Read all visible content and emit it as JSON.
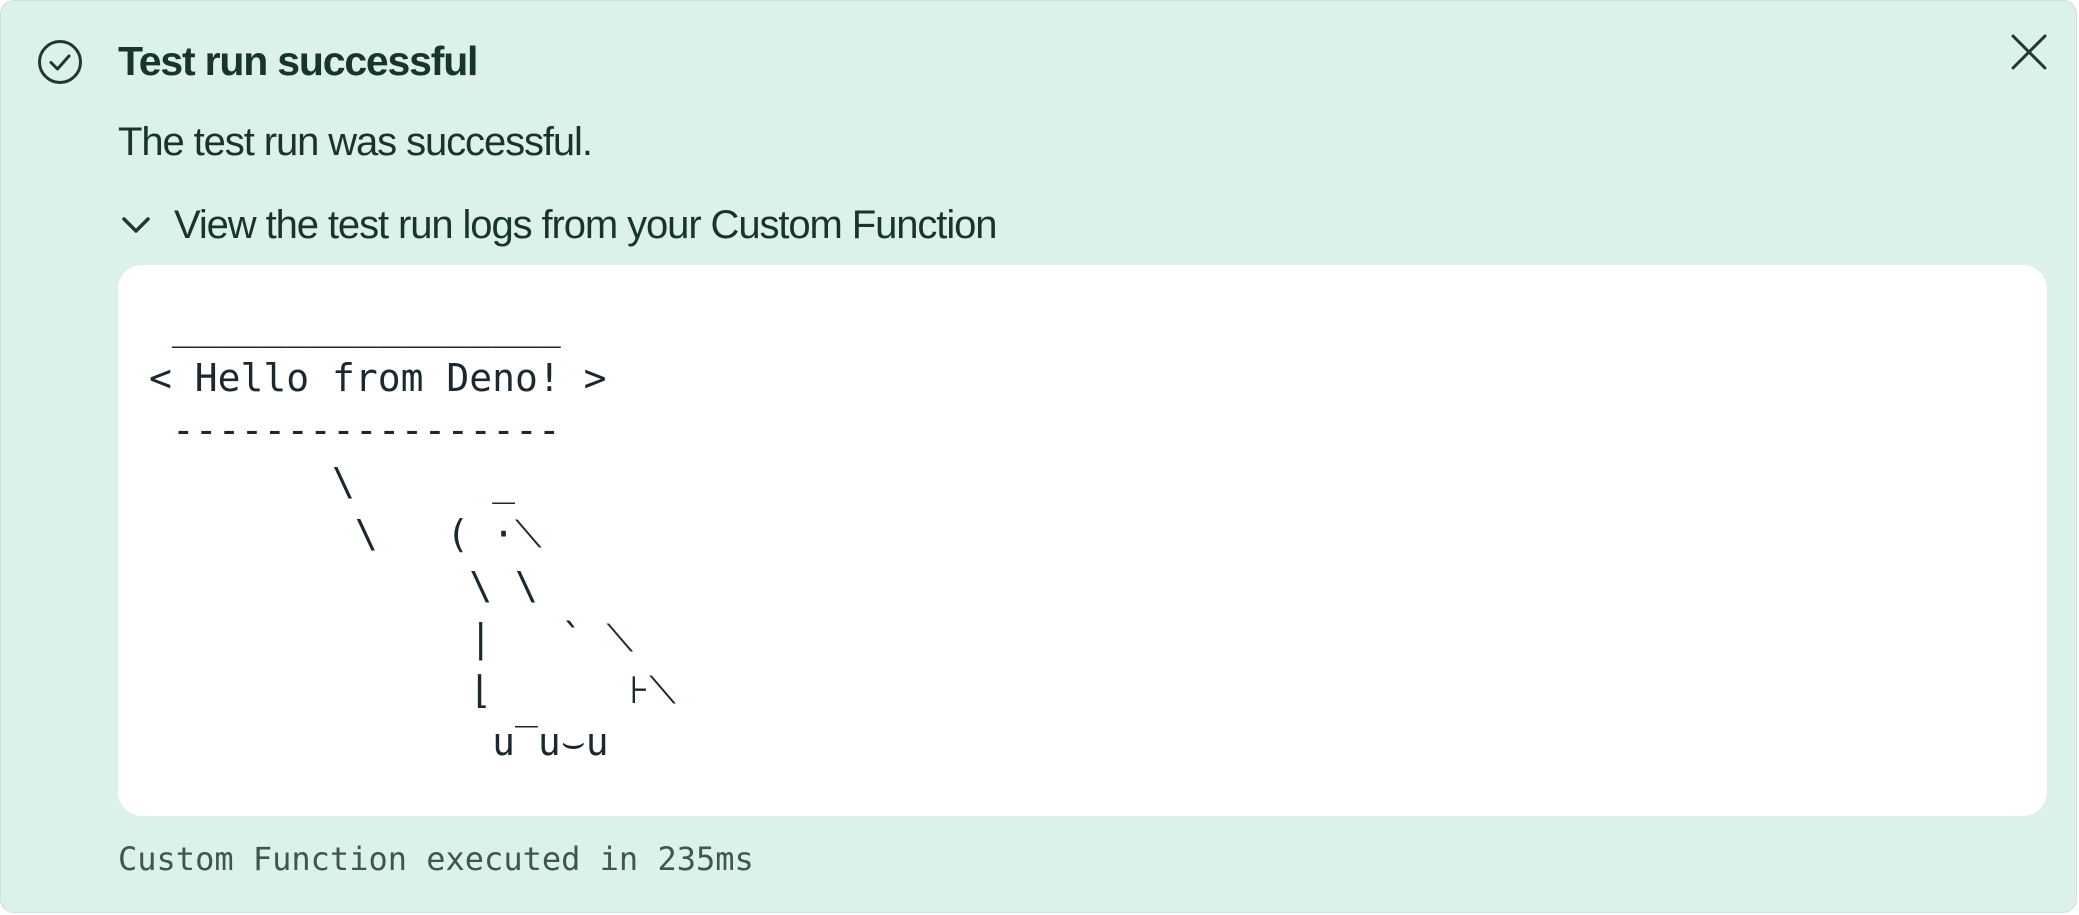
{
  "alert": {
    "title": "Test run successful",
    "message": "The test run was successful.",
    "logs_toggle_label": "View the test run logs from your Custom Function",
    "logs_output": " _________________\n< Hello from Deno! >\n -----------------\n        \\      _\n         \\   ( ·⟍\n              \\ \\\n              |   ` ⟍\n              ⌊      ⊦⟍\n               u‾u⌣u",
    "execution_summary": "Custom Function executed in 235ms",
    "icons": {
      "status": "check-circle-icon",
      "close": "close-icon",
      "toggle": "chevron-down-icon"
    },
    "colors": {
      "background": "#dbf1e9",
      "text": "#17352c",
      "log_background": "#ffffff"
    }
  }
}
